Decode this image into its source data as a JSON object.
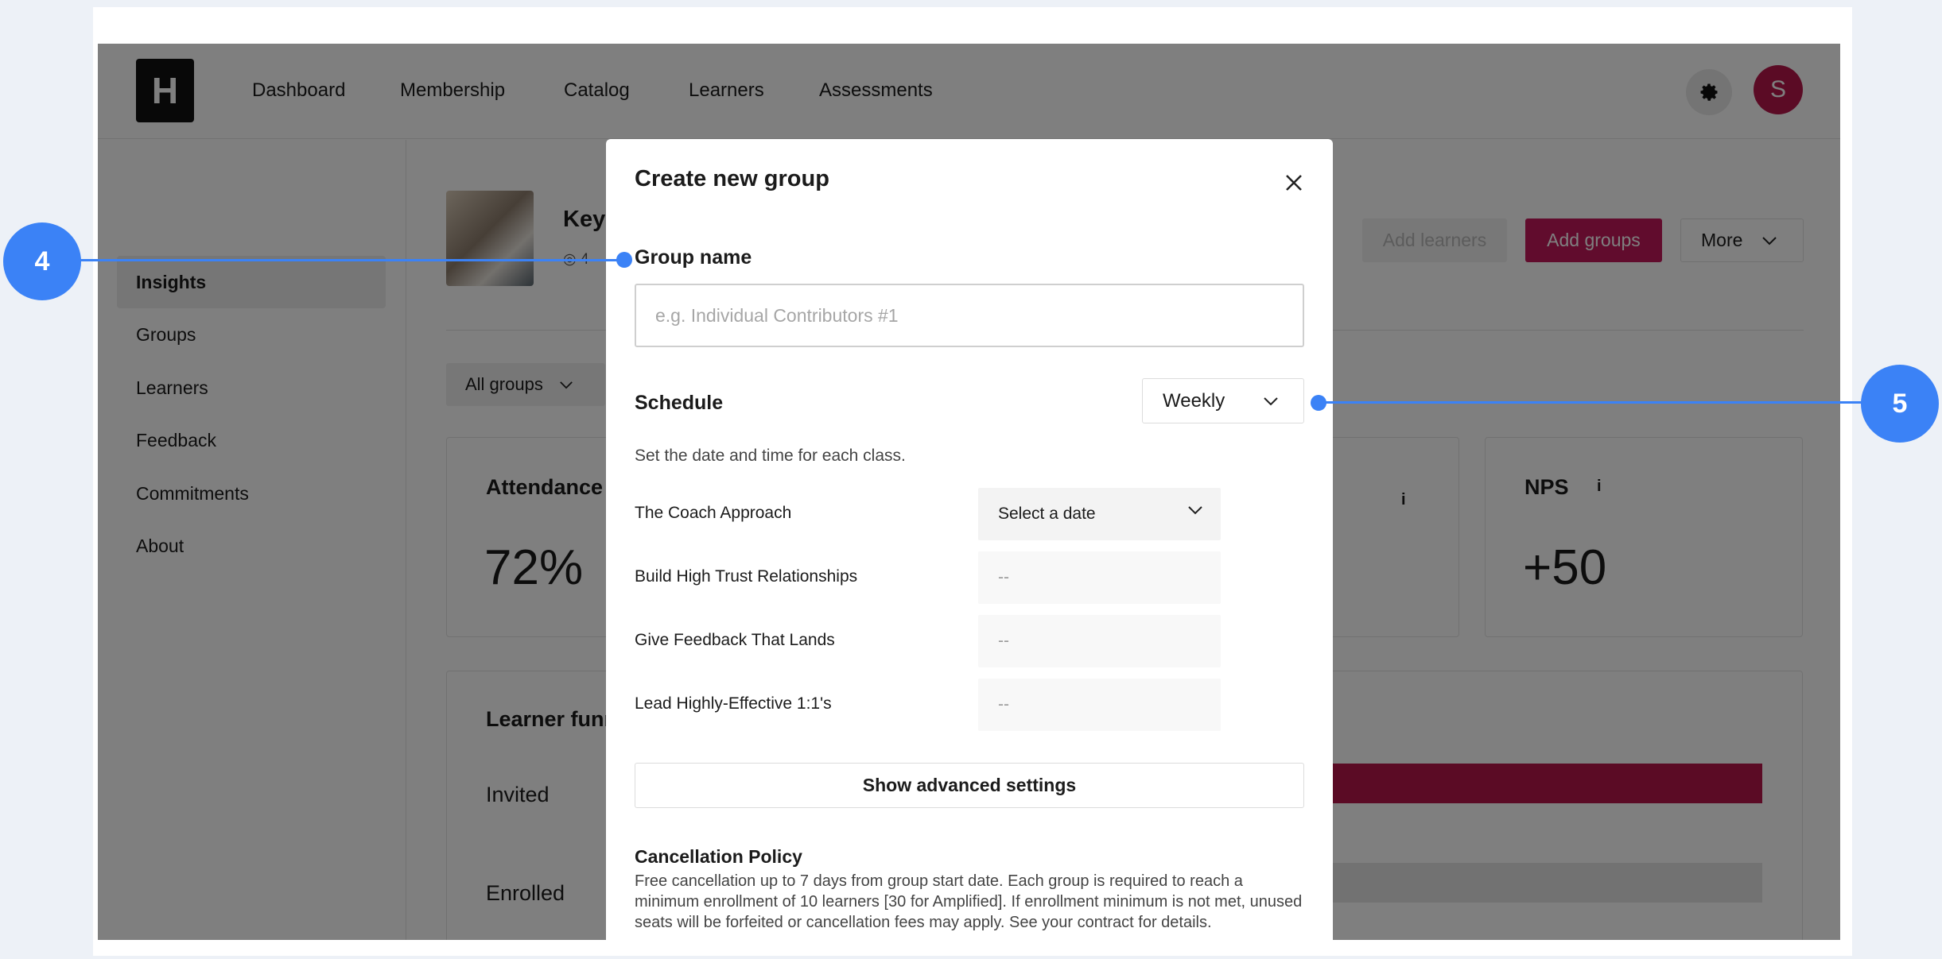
{
  "nav": {
    "logo_letter": "H",
    "links": [
      "Dashboard",
      "Membership",
      "Catalog",
      "Learners",
      "Assessments"
    ],
    "avatar_initial": "S"
  },
  "sidebar": {
    "items": [
      {
        "label": "Insights",
        "active": true
      },
      {
        "label": "Groups",
        "active": false
      },
      {
        "label": "Learners",
        "active": false
      },
      {
        "label": "Feedback",
        "active": false
      },
      {
        "label": "Commitments",
        "active": false
      },
      {
        "label": "About",
        "active": false
      }
    ]
  },
  "header": {
    "title": "Key",
    "meta": "4",
    "add_learners_label": "Add learners",
    "add_groups_label": "Add groups",
    "more_label": "More"
  },
  "filters": {
    "groups": "All groups"
  },
  "cards": {
    "attendance_label": "Attendance",
    "attendance_value": "72%",
    "nps_label": "NPS",
    "nps_info": "i",
    "nps_value": "+50",
    "mid_info": "i"
  },
  "funnel": {
    "title": "Learner funnel",
    "rows": [
      {
        "label": "Invited",
        "fill": 1.0
      },
      {
        "label": "Enrolled",
        "fill": 0.38
      }
    ]
  },
  "modal": {
    "title": "Create new group",
    "group_name_label": "Group name",
    "group_name_placeholder": "e.g. Individual Contributors #1",
    "group_name_value": "",
    "schedule_label": "Schedule",
    "schedule_value": "Weekly",
    "helper": "Set the date and time for each class.",
    "classes": [
      {
        "name": "The Coach Approach",
        "value": "Select a date"
      },
      {
        "name": "Build High Trust Relationships",
        "value": "--"
      },
      {
        "name": "Give Feedback That Lands",
        "value": "--"
      },
      {
        "name": "Lead Highly-Effective 1:1's",
        "value": "--"
      }
    ],
    "advanced_label": "Show advanced settings",
    "policy_title": "Cancellation Policy",
    "policy_text": "Free cancellation up to 7 days from group start date. Each group is required to reach a minimum enrollment of 10 learners [30 for Amplified]. If enrollment minimum is not met, unused seats will be forfeited or cancellation fees may apply. See your contract for details."
  },
  "callouts": {
    "c4": "4",
    "c5": "5"
  },
  "colors": {
    "accent": "#c2185b",
    "callout": "#3b82f6"
  }
}
